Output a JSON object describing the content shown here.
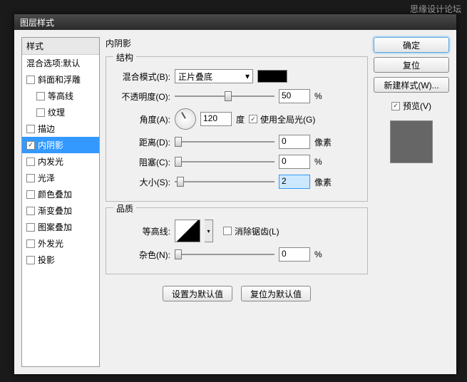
{
  "watermark": "思缘设计论坛",
  "window": {
    "title": "图层样式"
  },
  "sidebar": {
    "header": "样式",
    "blend_default": "混合选项:默认",
    "items": [
      {
        "label": "斜面和浮雕",
        "checked": false
      },
      {
        "label": "等高线",
        "checked": false,
        "indent": true
      },
      {
        "label": "纹理",
        "checked": false,
        "indent": true
      },
      {
        "label": "描边",
        "checked": false
      },
      {
        "label": "内阴影",
        "checked": true,
        "selected": true
      },
      {
        "label": "内发光",
        "checked": false
      },
      {
        "label": "光泽",
        "checked": false
      },
      {
        "label": "颜色叠加",
        "checked": false
      },
      {
        "label": "渐变叠加",
        "checked": false
      },
      {
        "label": "图案叠加",
        "checked": false
      },
      {
        "label": "外发光",
        "checked": false
      },
      {
        "label": "投影",
        "checked": false
      }
    ]
  },
  "panel": {
    "title": "内阴影",
    "structure": {
      "legend": "结构",
      "blend_mode_label": "混合模式(B):",
      "blend_mode_value": "正片叠底",
      "opacity_label": "不透明度(O):",
      "opacity_value": "50",
      "opacity_unit": "%",
      "angle_label": "角度(A):",
      "angle_value": "120",
      "angle_unit": "度",
      "global_light_label": "使用全局光(G)",
      "distance_label": "距离(D):",
      "distance_value": "0",
      "distance_unit": "像素",
      "choke_label": "阻塞(C):",
      "choke_value": "0",
      "choke_unit": "%",
      "size_label": "大小(S):",
      "size_value": "2",
      "size_unit": "像素"
    },
    "quality": {
      "legend": "品质",
      "contour_label": "等高线:",
      "antialias_label": "消除锯齿(L)",
      "noise_label": "杂色(N):",
      "noise_value": "0",
      "noise_unit": "%"
    },
    "set_default": "设置为默认值",
    "reset_default": "复位为默认值"
  },
  "right": {
    "ok": "确定",
    "cancel": "复位",
    "new_style": "新建样式(W)...",
    "preview_label": "预览(V)"
  }
}
